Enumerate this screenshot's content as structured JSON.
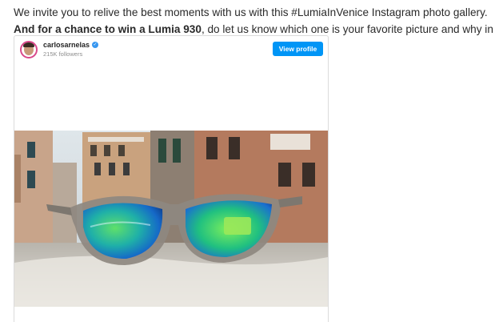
{
  "article": {
    "intro_part1": "We invite you to relive the best moments with us with this #LumiaInVenice Instagram photo gallery. ",
    "intro_bold": "And for a chance to win a Lumia 930",
    "intro_part2": ", do let us know which one is your favorite picture and why in the comments below."
  },
  "embed": {
    "username": "carlosarnelas",
    "verified_mark": "✓",
    "followers": "215K followers",
    "view_profile_label": "View profile"
  },
  "colors": {
    "button": "#0095f6",
    "verified": "#3897f0",
    "avatar_ring": "#d9488a"
  },
  "icons": [
    "verified-icon",
    "avatar"
  ]
}
